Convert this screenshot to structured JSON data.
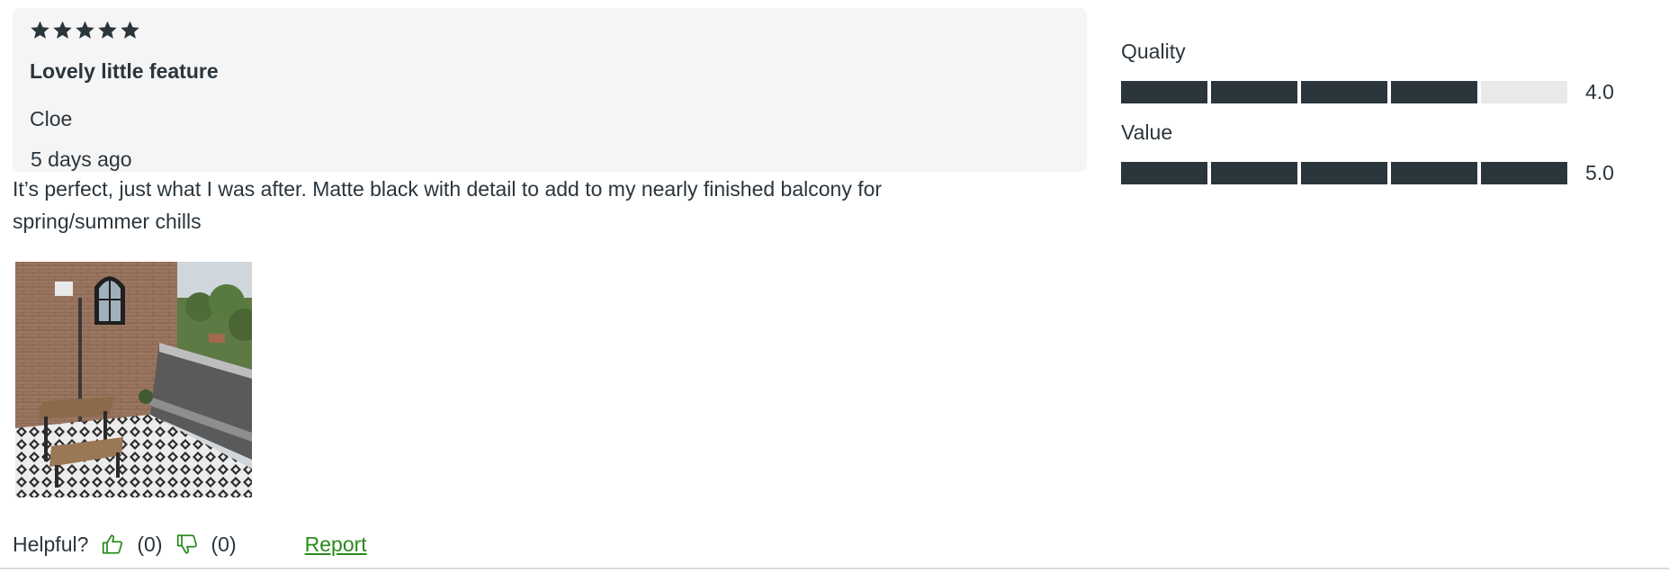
{
  "review": {
    "rating": 5,
    "rating_max": 5,
    "title": "Lovely little feature",
    "author": "Cloe",
    "date": "5 days ago",
    "body": "It’s perfect, just what I was after. Matte black with detail to add to my nearly finished balcony for spring/summer chills"
  },
  "photo": {
    "icon": "balcony-photo"
  },
  "helpful": {
    "label": "Helpful?",
    "up_icon": "thumbs-up-icon",
    "up_count": "(0)",
    "down_icon": "thumbs-down-icon",
    "down_count": "(0)",
    "report_label": "Report"
  },
  "ratings": [
    {
      "label": "Quality",
      "value": 4.0,
      "value_text": "4.0",
      "max": 5
    },
    {
      "label": "Value",
      "value": 5.0,
      "value_text": "5.0",
      "max": 5
    }
  ],
  "colors": {
    "text": "#2b353c",
    "bar_filled": "#2b353c",
    "bar_empty": "#e8e9eb",
    "panel_bg": "#f5f5f5",
    "link": "#2a8a1d"
  }
}
